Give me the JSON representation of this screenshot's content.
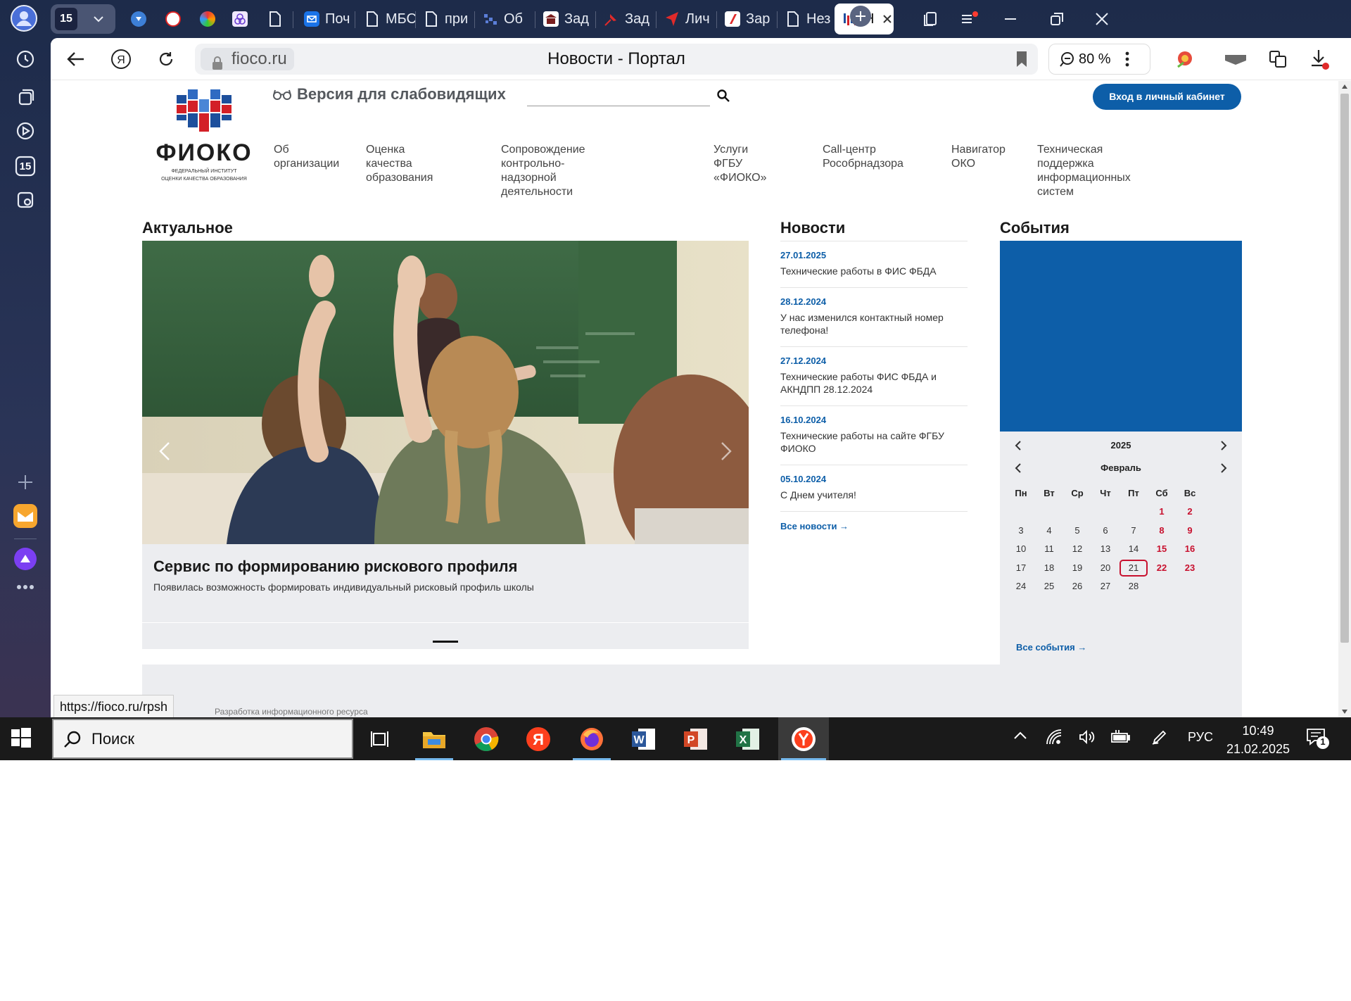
{
  "browser": {
    "sidebar_badge": "15",
    "tab_count": "15",
    "tabs": [
      {
        "label": "Поч"
      },
      {
        "label": "МБС"
      },
      {
        "label": "при"
      },
      {
        "label": "Об"
      },
      {
        "label": "Зад"
      },
      {
        "label": "Зад"
      },
      {
        "label": "Лич"
      },
      {
        "label": "Зар"
      },
      {
        "label": "Нез"
      },
      {
        "label": "Н"
      }
    ],
    "address": {
      "domain": "fioco.ru",
      "page_title": "Новости - Портал"
    },
    "zoom": "80 %",
    "status_url": "https://fioco.ru/rpsh"
  },
  "site": {
    "logo": {
      "name": "ФИОКО",
      "subtitle_line1": "ФЕДЕРАЛЬНЫЙ ИНСТИТУТ",
      "subtitle_line2": "ОЦЕНКИ КАЧЕСТВА ОБРАЗОВАНИЯ"
    },
    "vision_link": "Версия для слабовидящих",
    "login_button": "Вход в личный кабинет",
    "nav": [
      "Об\nорганизации",
      "Оценка качества\nобразования",
      "Сопровождение контрольно-\nнадзорной деятельности",
      "Услуги ФГБУ\n«ФИОКО»",
      "Call-центр\nРособрнадзора",
      "Навигатор\nОКО",
      "Техническая поддержка\nинформационных систем"
    ],
    "actual": {
      "title": "Актуальное",
      "slide_title": "Сервис по формированию рискового профиля",
      "slide_desc": "Появилась возможность формировать индивидуальный рисковый профиль школы"
    },
    "news": {
      "title": "Новости",
      "items": [
        {
          "date": "27.01.2025",
          "text": "Технические работы в ФИС ФБДА"
        },
        {
          "date": "28.12.2024",
          "text": "У нас изменился контактный номер телефона!"
        },
        {
          "date": "27.12.2024",
          "text": "Технические работы ФИС ФБДА и АКНДПП 28.12.2024"
        },
        {
          "date": "16.10.2024",
          "text": "Технические работы на сайте ФГБУ ФИОКО"
        },
        {
          "date": "05.10.2024",
          "text": "С Днем учителя!"
        }
      ],
      "all_link": "Все новости →"
    },
    "events": {
      "title": "События",
      "year": "2025",
      "month": "Февраль",
      "weekdays": [
        "Пн",
        "Вт",
        "Ср",
        "Чт",
        "Пт",
        "Сб",
        "Вс"
      ],
      "weeks": [
        [
          "",
          "",
          "",
          "",
          "",
          "1",
          "2"
        ],
        [
          "3",
          "4",
          "5",
          "6",
          "7",
          "8",
          "9"
        ],
        [
          "10",
          "11",
          "12",
          "13",
          "14",
          "15",
          "16"
        ],
        [
          "17",
          "18",
          "19",
          "20",
          "21",
          "22",
          "23"
        ],
        [
          "24",
          "25",
          "26",
          "27",
          "28",
          "",
          ""
        ]
      ],
      "today": "21",
      "all_link": "Все события →"
    },
    "footer_partial": "Разработка информационного ресурса"
  },
  "taskbar": {
    "search_placeholder": "Поиск",
    "language": "РУС",
    "time": "10:49",
    "date": "21.02.2025",
    "notification_count": "1"
  },
  "colors": {
    "brand_blue": "#0d5ea8",
    "weekend_red": "#c8102e"
  }
}
